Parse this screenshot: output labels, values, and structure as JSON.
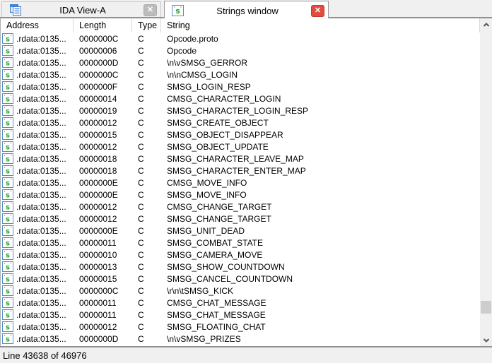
{
  "tabs": [
    {
      "label": "IDA View-A",
      "icon": "ida-view-icon",
      "active": false
    },
    {
      "label": "Strings window",
      "icon": "strings-icon",
      "active": true
    }
  ],
  "table": {
    "columns": [
      "Address",
      "Length",
      "Type",
      "String"
    ],
    "rows": [
      {
        "address": ".rdata:0135...",
        "length": "0000000C",
        "type": "C",
        "string": "Opcode.proto"
      },
      {
        "address": ".rdata:0135...",
        "length": "00000006",
        "type": "C",
        "string": "Opcode"
      },
      {
        "address": ".rdata:0135...",
        "length": "0000000D",
        "type": "C",
        "string": "\\n\\vSMSG_GERROR"
      },
      {
        "address": ".rdata:0135...",
        "length": "0000000C",
        "type": "C",
        "string": "\\n\\nCMSG_LOGIN"
      },
      {
        "address": ".rdata:0135...",
        "length": "0000000F",
        "type": "C",
        "string": "SMSG_LOGIN_RESP"
      },
      {
        "address": ".rdata:0135...",
        "length": "00000014",
        "type": "C",
        "string": "CMSG_CHARACTER_LOGIN"
      },
      {
        "address": ".rdata:0135...",
        "length": "00000019",
        "type": "C",
        "string": "SMSG_CHARACTER_LOGIN_RESP"
      },
      {
        "address": ".rdata:0135...",
        "length": "00000012",
        "type": "C",
        "string": "SMSG_CREATE_OBJECT"
      },
      {
        "address": ".rdata:0135...",
        "length": "00000015",
        "type": "C",
        "string": "SMSG_OBJECT_DISAPPEAR"
      },
      {
        "address": ".rdata:0135...",
        "length": "00000012",
        "type": "C",
        "string": "SMSG_OBJECT_UPDATE"
      },
      {
        "address": ".rdata:0135...",
        "length": "00000018",
        "type": "C",
        "string": "SMSG_CHARACTER_LEAVE_MAP"
      },
      {
        "address": ".rdata:0135...",
        "length": "00000018",
        "type": "C",
        "string": "SMSG_CHARACTER_ENTER_MAP"
      },
      {
        "address": ".rdata:0135...",
        "length": "0000000E",
        "type": "C",
        "string": "CMSG_MOVE_INFO"
      },
      {
        "address": ".rdata:0135...",
        "length": "0000000E",
        "type": "C",
        "string": "SMSG_MOVE_INFO"
      },
      {
        "address": ".rdata:0135...",
        "length": "00000012",
        "type": "C",
        "string": "CMSG_CHANGE_TARGET"
      },
      {
        "address": ".rdata:0135...",
        "length": "00000012",
        "type": "C",
        "string": "SMSG_CHANGE_TARGET"
      },
      {
        "address": ".rdata:0135...",
        "length": "0000000E",
        "type": "C",
        "string": "SMSG_UNIT_DEAD"
      },
      {
        "address": ".rdata:0135...",
        "length": "00000011",
        "type": "C",
        "string": "SMSG_COMBAT_STATE"
      },
      {
        "address": ".rdata:0135...",
        "length": "00000010",
        "type": "C",
        "string": "SMSG_CAMERA_MOVE"
      },
      {
        "address": ".rdata:0135...",
        "length": "00000013",
        "type": "C",
        "string": "SMSG_SHOW_COUNTDOWN"
      },
      {
        "address": ".rdata:0135...",
        "length": "00000015",
        "type": "C",
        "string": "SMSG_CANCEL_COUNTDOWN"
      },
      {
        "address": ".rdata:0135...",
        "length": "0000000C",
        "type": "C",
        "string": "\\r\\n\\tSMSG_KICK"
      },
      {
        "address": ".rdata:0135...",
        "length": "00000011",
        "type": "C",
        "string": "CMSG_CHAT_MESSAGE"
      },
      {
        "address": ".rdata:0135...",
        "length": "00000011",
        "type": "C",
        "string": "SMSG_CHAT_MESSAGE"
      },
      {
        "address": ".rdata:0135...",
        "length": "00000012",
        "type": "C",
        "string": "SMSG_FLOATING_CHAT"
      },
      {
        "address": ".rdata:0135...",
        "length": "0000000D",
        "type": "C",
        "string": "\\n\\vSMSG_PRIZES"
      }
    ]
  },
  "status_bar": {
    "text": "Line 43638 of 46976"
  },
  "controls": {
    "close_glyph": "✕"
  },
  "colors": {
    "active_close_red": "#e14b42",
    "inactive_close_gray": "#bcbcbc",
    "icon_border_blue": "#4f8fd0",
    "icon_s_green": "#2e9e2e",
    "tabbar_line": "#8f9092",
    "scroll_thumb": "#cdcdcd",
    "background": "#f0f0f0"
  }
}
